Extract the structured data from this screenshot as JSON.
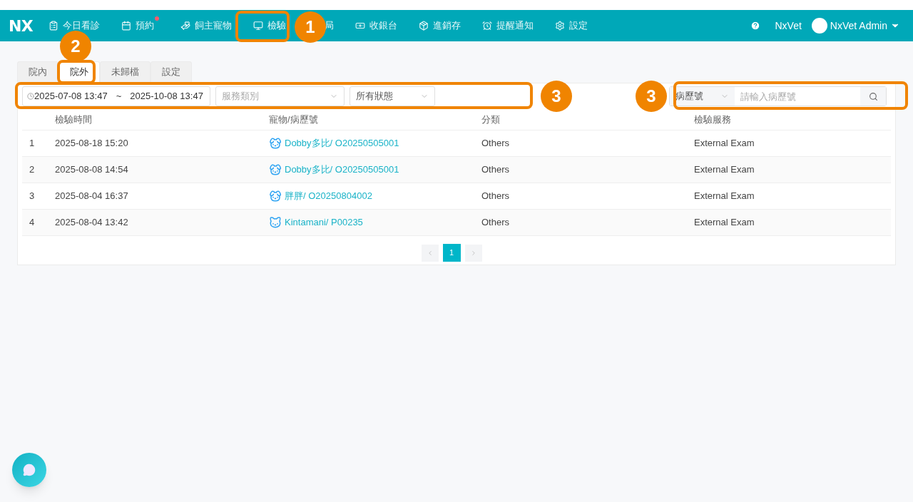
{
  "header": {
    "logo": "NX",
    "nav": [
      {
        "label": "今日看診",
        "dot": false
      },
      {
        "label": "預約",
        "dot": true
      },
      {
        "label": "飼主寵物",
        "dot": false
      },
      {
        "label": "檢驗",
        "dot": false
      },
      {
        "label": "局",
        "dot": false
      },
      {
        "label": "收銀台",
        "dot": false
      },
      {
        "label": "進銷存",
        "dot": false
      },
      {
        "label": "提醒通知",
        "dot": false
      },
      {
        "label": "設定",
        "dot": false
      }
    ],
    "clinic": "NxVet",
    "user": "NxVet Admin"
  },
  "tabs": [
    {
      "label": "院內",
      "selected": false
    },
    {
      "label": "院外",
      "selected": true
    },
    {
      "label": "未歸檔",
      "selected": false
    },
    {
      "label": "設定",
      "selected": false
    }
  ],
  "filters": {
    "date_from": "2025-07-08 13:47",
    "separator": "~",
    "date_to": "2025-10-08 13:47",
    "service_placeholder": "服務類別",
    "status": "所有狀態",
    "search_type": "病歷號",
    "search_placeholder": "請輸入病歷號"
  },
  "table": {
    "columns": [
      "檢驗時間",
      "寵物/病歷號",
      "分類",
      "檢驗服務"
    ],
    "rows": [
      {
        "index": "1",
        "time": "2025-08-18 15:20",
        "kind": "dog",
        "pet": "Dobby多比/ O20250505001",
        "category": "Others",
        "service": "External Exam"
      },
      {
        "index": "2",
        "time": "2025-08-08 14:54",
        "kind": "dog",
        "pet": "Dobby多比/ O20250505001",
        "category": "Others",
        "service": "External Exam"
      },
      {
        "index": "3",
        "time": "2025-08-04 16:37",
        "kind": "dog",
        "pet": "胖胖/ O20250804002",
        "category": "Others",
        "service": "External Exam"
      },
      {
        "index": "4",
        "time": "2025-08-04 13:42",
        "kind": "cat",
        "pet": "Kintamani/ P00235",
        "category": "Others",
        "service": "External Exam"
      }
    ]
  },
  "pagination": {
    "pages": [
      {
        "label": "1",
        "selected": true
      }
    ]
  },
  "callouts": [
    {
      "number": "1"
    },
    {
      "number": "2"
    },
    {
      "number": "3"
    },
    {
      "number": "3"
    }
  ]
}
